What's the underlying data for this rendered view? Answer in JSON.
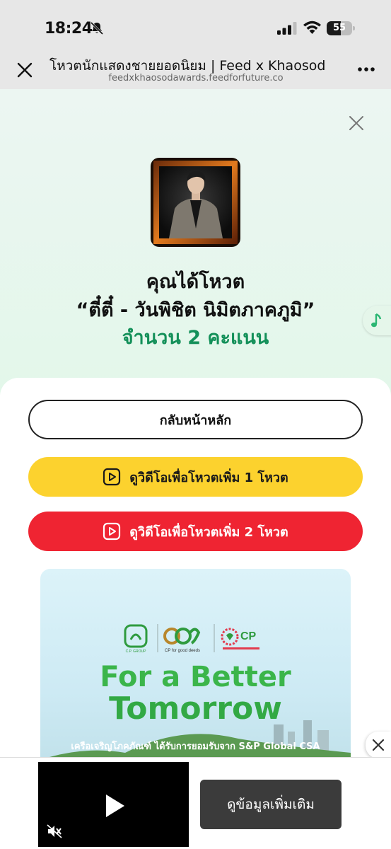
{
  "status": {
    "time": "18:24",
    "battery": "55",
    "battery_level": 0.55
  },
  "browser": {
    "title": "โหวตนักแสดงชายยอดนิยม | Feed x Khaosod",
    "url": "feedxkhaosodawards.feedforfuture.co"
  },
  "result": {
    "voted_label": "คุณได้โหวต",
    "candidate": "“ตี๋ตี๋ - วันพิชิต นิมิตภาคภูมิ”",
    "score": "จำนวน 2 คะแนน"
  },
  "buttons": {
    "home": "กลับหน้าหลัก",
    "video_one": "ดูวิดีโอเพื่อโหวตเพิ่ม 1 โหวต",
    "video_two": "ดูวิดีโอเพื่อโหวตเพิ่ม 2 โหวต"
  },
  "banner": {
    "title_line1": "For a Better",
    "title_line2": "Tomorrow",
    "subtitle": "เครือเจริญโภคภัณฑ์ ได้รับการยอมรับจาก S&P Global CSA",
    "logo_cp_group": "C.P. GROUP",
    "logo_good_deeds": "CP for good deeds",
    "logo_cp": "CP"
  },
  "ad": {
    "cta": "ดูข้อมูลเพิ่มเติม"
  },
  "colors": {
    "accent_green": "#139059",
    "yellow_button": "#fcd22e",
    "red_button": "#ef2432"
  }
}
